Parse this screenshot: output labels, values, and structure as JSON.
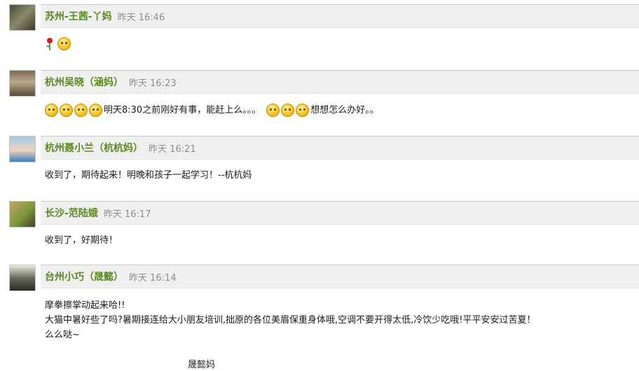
{
  "posts": [
    {
      "author": "苏州-王茜-丫妈",
      "time": "昨天 16:46",
      "lines": [
        ""
      ]
    },
    {
      "author": "杭州吴晓（涵妈）",
      "time": "昨天 16:23",
      "lines": [
        "明天8:30之前刚好有事，能赶上么。。。",
        "想想怎么办好。。"
      ]
    },
    {
      "author": "杭州聂小兰（杭杭妈）",
      "time": "昨天 16:21",
      "lines": [
        "收到了，期待起来！明晚和孩子一起学习！--杭杭妈"
      ]
    },
    {
      "author": "长沙-范陆娥",
      "time": "昨天 16:17",
      "lines": [
        "收到了，好期待！"
      ]
    },
    {
      "author": "台州小巧（晟懿）",
      "time": "昨天 16:14",
      "lines": [
        "摩拳擦掌动起来哈!!",
        "大猫中暑好些了吗?暑期接连给大小朋友培训,拙原的各位美眉保重身体哦,空调不要开得太低,冷饮少吃哦!平平安安过苦夏！",
        "么么哒~"
      ],
      "signature": "晟懿妈"
    }
  ],
  "icons": {
    "rose": "rose-icon",
    "emoticon": "smiley-emoticon-icon"
  },
  "colors": {
    "author": "#5a8a1e",
    "time": "#8d8d8d",
    "header_bar": "#efefef"
  }
}
